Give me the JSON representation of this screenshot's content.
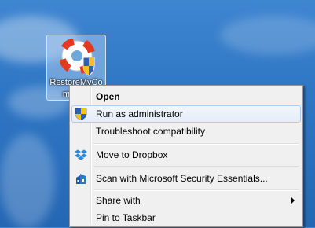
{
  "desktop": {
    "icon": {
      "label": "RestoreMyComputer",
      "icon": "lifebuoy-shield-icon"
    }
  },
  "context_menu": {
    "items": [
      {
        "label": "Open",
        "bold": true
      },
      {
        "label": "Run as administrator",
        "icon": "uac-shield-icon",
        "highlighted": true
      },
      {
        "label": "Troubleshoot compatibility"
      },
      {
        "label": "Move to Dropbox",
        "icon": "dropbox-icon"
      },
      {
        "label": "Scan with Microsoft Security Essentials...",
        "icon": "security-essentials-icon"
      },
      {
        "label": "Share with",
        "submenu": true
      },
      {
        "label": "Pin to Taskbar"
      }
    ]
  }
}
